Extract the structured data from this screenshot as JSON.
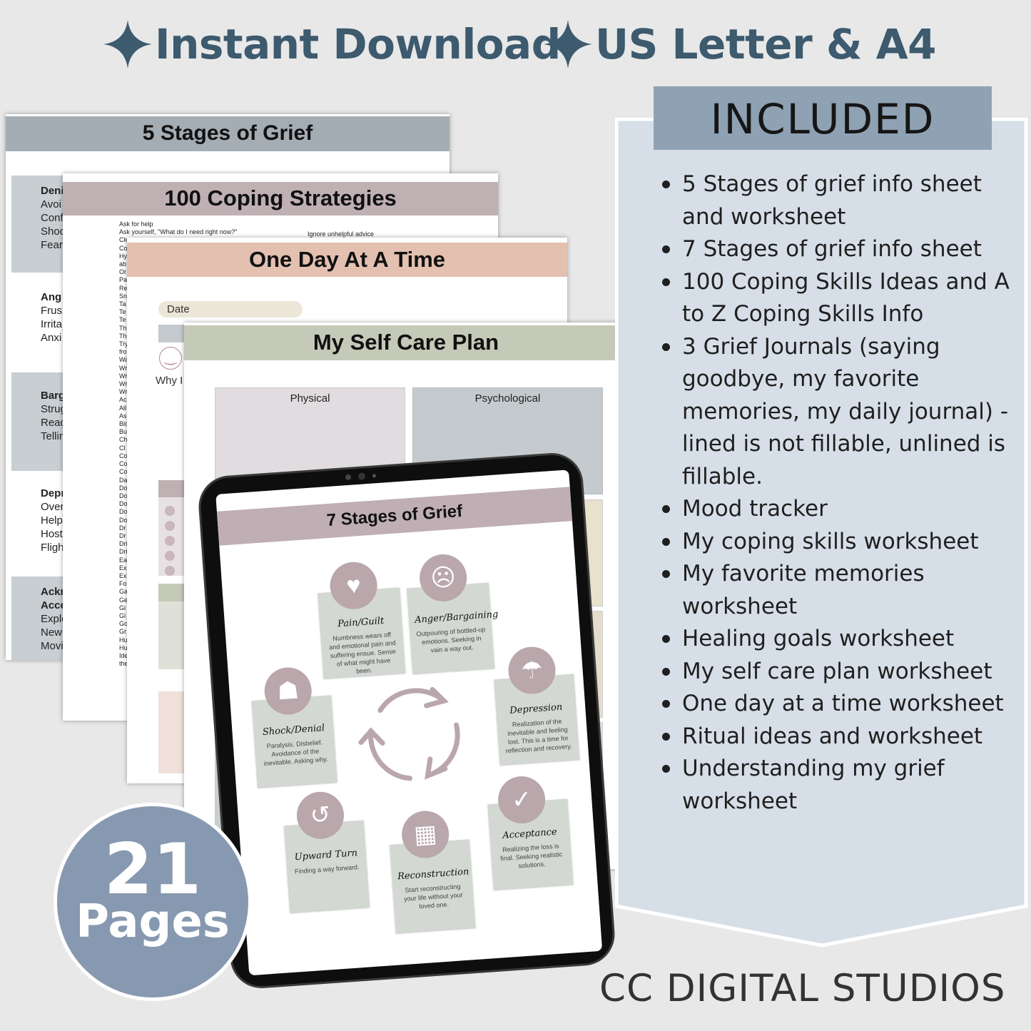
{
  "header": {
    "badge_1": "Instant Download",
    "badge_2": "US Letter & A4",
    "icon": "four-point-star-icon",
    "color": "#3d5a6e"
  },
  "page_five_stages": {
    "title": "5 Stages of Grief",
    "sections": [
      {
        "lines": [
          "Deni",
          "Avoi",
          "Conf",
          "Shoc",
          "Fear"
        ]
      },
      {
        "lines": [
          "Ang",
          "Frus",
          "Irrita",
          "Anxi"
        ]
      },
      {
        "lines": [
          "Barg",
          "Strug",
          "Read",
          "Tellin"
        ]
      },
      {
        "lines": [
          "Depr",
          "Over",
          "Help",
          "Host",
          "Fligh"
        ]
      },
      {
        "lines": [
          "Ackn",
          "Acce",
          "Explo",
          "New",
          "Movi"
        ]
      }
    ]
  },
  "page_coping": {
    "title": "100 Coping Strategies",
    "col1": [
      "Ask for help",
      "Ask yourself, \"What do I need right now?\"",
      "Cle",
      "Co",
      "Hy",
      "ab",
      "Or",
      "Pa",
      "Re",
      "Sn",
      "Ta",
      "Te",
      "Te",
      "Th",
      "Th",
      "Try",
      "fro",
      "Wa",
      "Wr",
      "Wr",
      "Wr",
      "Wr",
      "Ac",
      "All",
      "As",
      "Blo",
      "Bu",
      "Ch",
      "Cl",
      "Co",
      "Co",
      "Co",
      "Da",
      "Do",
      "Do",
      "Do",
      "Do",
      "Do",
      "Dr",
      "Dr",
      "Dri",
      "Dri",
      "Ea",
      "Ex",
      "Ex",
      "Fo",
      "Ga",
      "Ge",
      "Gi",
      "Gi",
      "Go",
      "Gr",
      "Hu",
      "Hu",
      "Ide",
      "the"
    ],
    "col2_first": "Ignore unhelpful advice"
  },
  "page_one_day": {
    "title": "One Day At A Time",
    "date_label": "Date",
    "why_label": "Why I",
    "mood_icon": "smiley-icon"
  },
  "page_self_care": {
    "title": "My Self Care Plan",
    "box_1": "Physical",
    "box_2": "Psychological"
  },
  "tablet": {
    "title": "7 Stages of Grief",
    "stages": [
      {
        "name": "Pain/Guilt",
        "desc": "Numbness wears off and emotional pain and suffering ensue. Sense of what might have been.",
        "icon": "broken-heart-icon"
      },
      {
        "name": "Anger/Bargaining",
        "desc": "Outpouring of bottled-up emotions.  Seeking in vain a way out.",
        "icon": "angry-person-icon"
      },
      {
        "name": "Depression",
        "desc": "Realization of the inevitable and feeling lost. This is a time for reflection and recovery.",
        "icon": "sad-person-icon"
      },
      {
        "name": "Shock/Denial",
        "desc": "Paralysis.  Disbelief. Avoidance of the inevitable.  Asking why.",
        "icon": "head-in-hands-icon"
      },
      {
        "name": "Upward Turn",
        "desc": "Finding a way forward.",
        "icon": "upward-arrow-icon"
      },
      {
        "name": "Reconstruction",
        "desc": "Start reconstructing your life without your loved one.",
        "icon": "building-blocks-icon"
      },
      {
        "name": "Acceptance",
        "desc": "Realizing the loss is final.  Seeking realistic solutions.",
        "icon": "checkmark-icon"
      }
    ],
    "cycle_icon": "circular-arrows-icon"
  },
  "included": {
    "heading": "INCLUDED",
    "items": [
      "5 Stages of grief info sheet and worksheet",
      "7 Stages of grief info sheet",
      "100 Coping Skills Ideas and A to Z Coping Skills Info",
      "3 Grief Journals (saying goodbye, my favorite memories, my daily journal) - lined is not fillable, unlined is fillable.",
      "Mood tracker",
      "My coping skills worksheet",
      "My favorite memories worksheet",
      "Healing goals worksheet",
      "My self care plan worksheet",
      "One day at a time worksheet",
      "Ritual ideas and worksheet",
      "Understanding my grief worksheet"
    ]
  },
  "pages_badge": {
    "count": "21",
    "label": "Pages"
  },
  "brand": "CC DIGITAL STUDIOS",
  "colors": {
    "background": "#e8e8e8",
    "banner": "#d6dfe8",
    "included_box": "#8fa2b3",
    "badge": "#8799b0",
    "mauve": "#b9a7ac",
    "sage": "#d3d8d3"
  }
}
